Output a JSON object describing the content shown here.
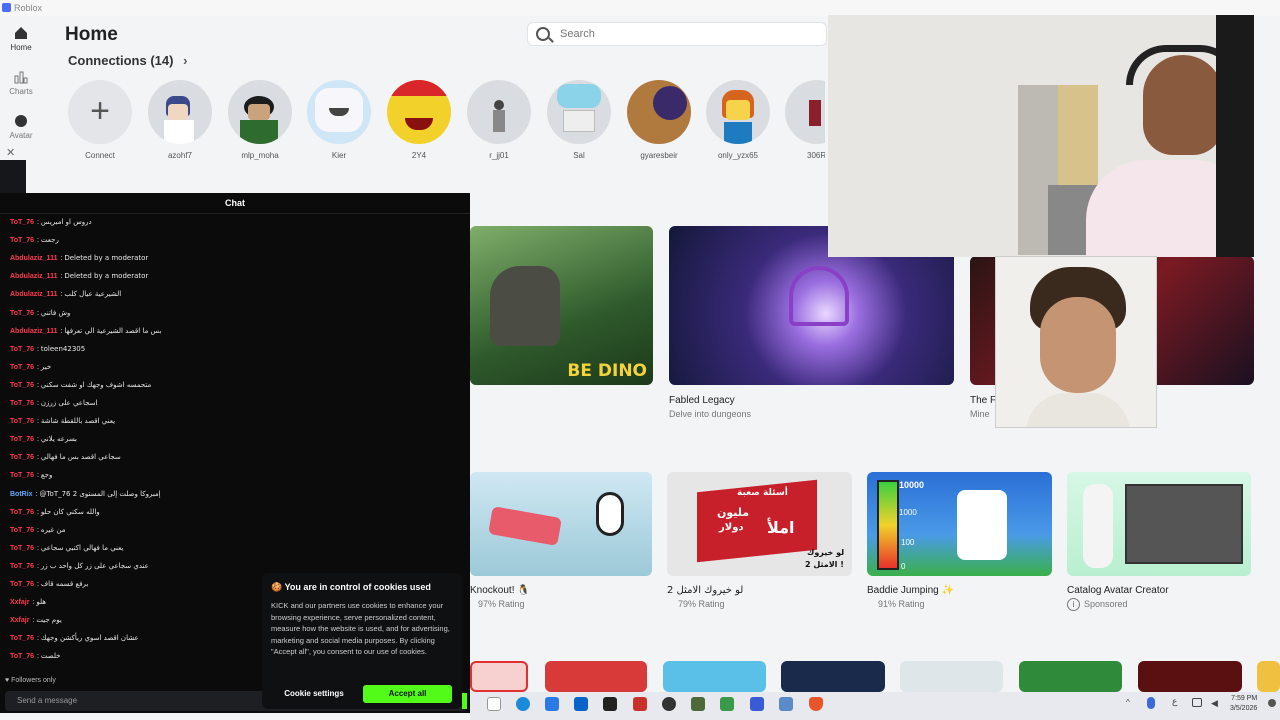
{
  "window": {
    "title": "Roblox"
  },
  "nav": {
    "home": "Home",
    "charts": "Charts",
    "avatar": "Avatar"
  },
  "header": {
    "title": "Home",
    "search_placeholder": "Search"
  },
  "connections": {
    "title": "Connections (14)",
    "items": [
      "Connect",
      "azohf7",
      "mlp_moha",
      "Kier",
      "2Y4",
      "r_jj01",
      "Sal",
      "gyaresbeir",
      "only_yzx65",
      "306R"
    ]
  },
  "games_row1": [
    {
      "title": "",
      "subtitle": "",
      "overlay": "BE DINO"
    },
    {
      "title": "Fabled Legacy",
      "subtitle": "Delve into dungeons"
    },
    {
      "title": "The F",
      "subtitle": "Mine"
    }
  ],
  "games_row2": [
    {
      "title": "Knockout! 🐧",
      "rating": "97% Rating"
    },
    {
      "title": "لو خيروك الامثل 2",
      "rating": "79% Rating"
    },
    {
      "title": "Baddie Jumping ✨",
      "rating": "91% Rating"
    },
    {
      "title": "Catalog Avatar Creator",
      "rating": "Sponsored"
    }
  ],
  "meter": {
    "top": "10000",
    "mid1": "1000",
    "mid2": "100",
    "low": "0"
  },
  "thumb_ar": {
    "line1": "أسئلة صعبة",
    "line2": "مليون",
    "line3": "دولار",
    "line4": "املأ",
    "line5": "لو خيروك",
    "line6": "الامثل 2 !"
  },
  "chat": {
    "title": "Chat",
    "messages": [
      {
        "user": "ToT_76",
        "text": "دروس او امبريس"
      },
      {
        "user": "ToT_76",
        "text": "رجعت"
      },
      {
        "user": "Abdulaziz_111",
        "text": "Deleted by a moderator"
      },
      {
        "user": "Abdulaziz_111",
        "text": "Deleted by a moderator"
      },
      {
        "user": "Abdulaziz_111",
        "text": "الشيرعية عيال كلب"
      },
      {
        "user": "ToT_76",
        "text": "وش فاتني"
      },
      {
        "user": "Abdulaziz_111",
        "text": "بس ما اقصد الشيرعية الي تعرفها"
      },
      {
        "user": "ToT_76",
        "text": "toleen42305"
      },
      {
        "user": "ToT_76",
        "text": "خير"
      },
      {
        "user": "ToT_76",
        "text": "متحمسه اشوف وجهك او شفت سكني"
      },
      {
        "user": "ToT_76",
        "text": "اسجاعي على زرزن"
      },
      {
        "user": "ToT_76",
        "text": "يعني اقصد باللقطة شاشة"
      },
      {
        "user": "ToT_76",
        "text": "بسرعه يلاني"
      },
      {
        "user": "ToT_76",
        "text": "سجاعي اقصد بس ما فهالي"
      },
      {
        "user": "ToT_76",
        "text": "وجع"
      },
      {
        "user": "BotRix",
        "text": "@ToT_76 إمبروكا وصلت إلى المستوى 2"
      },
      {
        "user": "ToT_76",
        "text": "والله سكني كان حلو"
      },
      {
        "user": "ToT_76",
        "text": "من غيره"
      },
      {
        "user": "ToT_76",
        "text": "يعني ما فهالي اكتبي سجاعي"
      },
      {
        "user": "ToT_76",
        "text": "عندي سجاعي على زر كل واحد ب زر"
      },
      {
        "user": "ToT_76",
        "text": "برفع قسمه قاف"
      },
      {
        "user": "Xxfajr",
        "text": "هلو"
      },
      {
        "user": "Xxfajr",
        "text": "يوم جيت"
      },
      {
        "user": "ToT_76",
        "text": "عشان اقصد اسوي ريأكشن وجهك"
      },
      {
        "user": "ToT_76",
        "text": "خلصت"
      }
    ],
    "followers_only": "Followers only",
    "send_placeholder": "Send a message"
  },
  "cookie": {
    "title": "You are in control of cookies used",
    "body": "KICK and our partners use cookies to enhance your browsing experience, serve personalized content, measure how the website is used, and for advertising, marketing and social media purposes. By clicking \"Accept all\", you consent to our use of cookies.",
    "settings": "Cookie settings",
    "accept": "Accept all"
  },
  "taskbar": {
    "time": "7:59 PM",
    "date": "3/5/2026"
  },
  "colors": {
    "accent_green": "#53fc18",
    "chat_user": "#ff3b4f",
    "bot_user": "#61a7ff"
  }
}
